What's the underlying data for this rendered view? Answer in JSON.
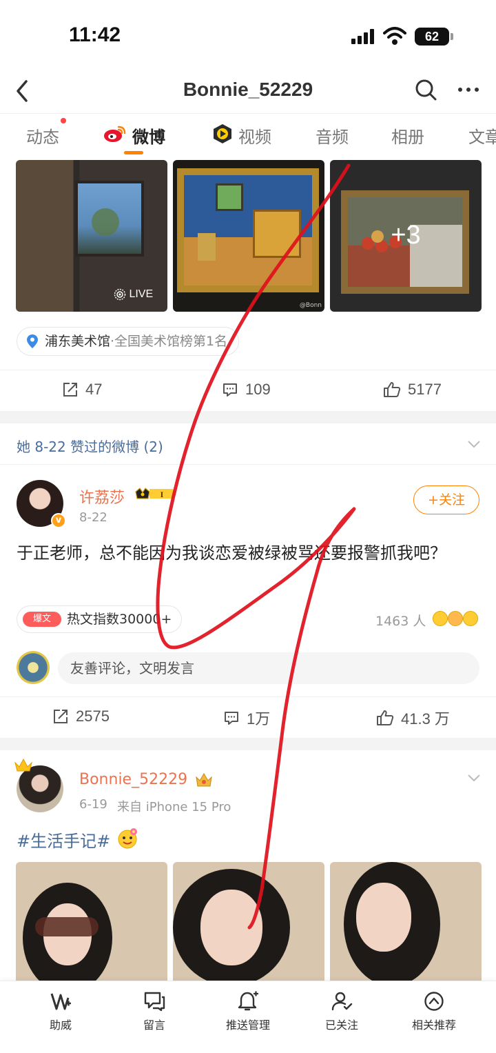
{
  "status": {
    "time": "11:42",
    "battery": "62"
  },
  "nav": {
    "title": "Bonnie_52229"
  },
  "tabs": [
    {
      "label": "动态",
      "has_dot": true
    },
    {
      "label": "微博",
      "active": true
    },
    {
      "label": "视频"
    },
    {
      "label": "音频"
    },
    {
      "label": "相册"
    },
    {
      "label": "文章"
    }
  ],
  "post1": {
    "live_label": "LIVE",
    "more_count": "+3",
    "watermark": "@Bonn",
    "location": {
      "name": "浦东美术馆",
      "sub": "·全国美术馆榜第1名"
    },
    "reposts": "47",
    "comments": "109",
    "likes": "5177"
  },
  "liked_section": {
    "title": "她 8-22 赞过的微博 (2)"
  },
  "liked_post": {
    "username": "许荔莎",
    "vip_level": "I",
    "verified_mark": "v",
    "date": "8-22",
    "follow_label": "+关注",
    "text": "于正老师，总不能因为我谈恋爱被绿被骂还要报警抓我吧？",
    "hot_tag": "爆文",
    "hot_index": "热文指数30000+",
    "reaction_count": "1463 人",
    "comment_placeholder": "友善评论，文明发言",
    "reposts": "2575",
    "comments": "1万",
    "likes": "41.3 万"
  },
  "own_post": {
    "username": "Bonnie_52229",
    "date": "6-19",
    "source": "来自 iPhone 15 Pro",
    "topic": "#生活手记#"
  },
  "bottom_bar": [
    {
      "label": "助威",
      "icon": "cheer-icon"
    },
    {
      "label": "留言",
      "icon": "message-icon"
    },
    {
      "label": "推送管理",
      "icon": "bell-icon"
    },
    {
      "label": "已关注",
      "icon": "followed-user-icon"
    },
    {
      "label": "相关推荐",
      "icon": "recommend-icon"
    }
  ],
  "colors": {
    "accent": "#ff8200",
    "link": "#4a6c9a",
    "username": "#eb7350",
    "scribble": "#e0101c"
  }
}
